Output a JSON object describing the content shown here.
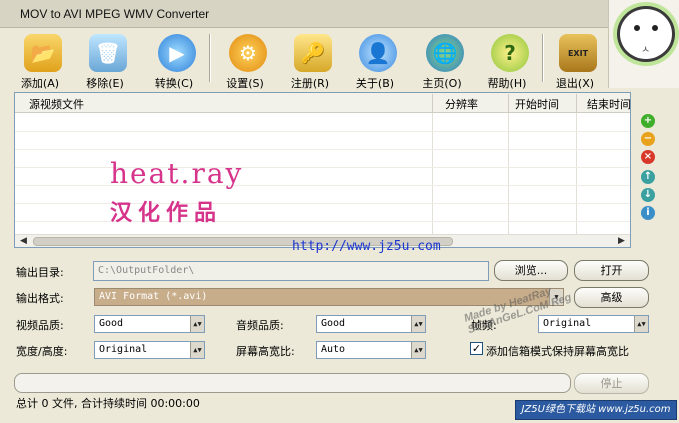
{
  "window": {
    "title": "MOV to AVI MPEG WMV Converter"
  },
  "toolbar": {
    "add": "添加(A)",
    "remove": "移除(E)",
    "convert": "转换(C)",
    "settings": "设置(S)",
    "register": "注册(R)",
    "about": "关于(B)",
    "home": "主页(O)",
    "help": "帮助(H)",
    "exit": "退出(X)",
    "exit_sign": "EXIT"
  },
  "list": {
    "columns": [
      "源视频文件",
      "分辨率",
      "开始时间",
      "结束时间"
    ]
  },
  "watermark": {
    "line1": "heat.ray",
    "line2": "汉化作品",
    "url": "http://www.jz5u.com",
    "stamp": "Made by HeatRay SoftAnGeL.CoM Reg"
  },
  "output": {
    "dir_label": "输出目录:",
    "dir_value": "C:\\OutputFolder\\",
    "browse": "浏览...",
    "open": "打开",
    "format_label": "输出格式:",
    "format_value": "AVI Format (*.avi)",
    "advanced": "高级"
  },
  "options": {
    "video_quality_label": "视频品质:",
    "video_quality": "Good",
    "audio_quality_label": "音频品质:",
    "audio_quality": "Good",
    "fps_label": "帧频:",
    "fps": "Original",
    "size_label": "宽度/高度:",
    "size": "Original",
    "aspect_label": "屏幕高宽比:",
    "aspect": "Auto",
    "letterbox_label": "添加信箱模式保持屏幕高宽比",
    "letterbox_checked": true
  },
  "progress": {
    "stop": "停止"
  },
  "status": {
    "text": "总计 0 文件, 合计持续时间 00:00:00"
  },
  "footer": {
    "badge": "JZ5U绿色下载站 www.jz5u.com"
  },
  "colors": {
    "accent_pink": "#d6338b",
    "link_blue": "#1b35d0"
  }
}
